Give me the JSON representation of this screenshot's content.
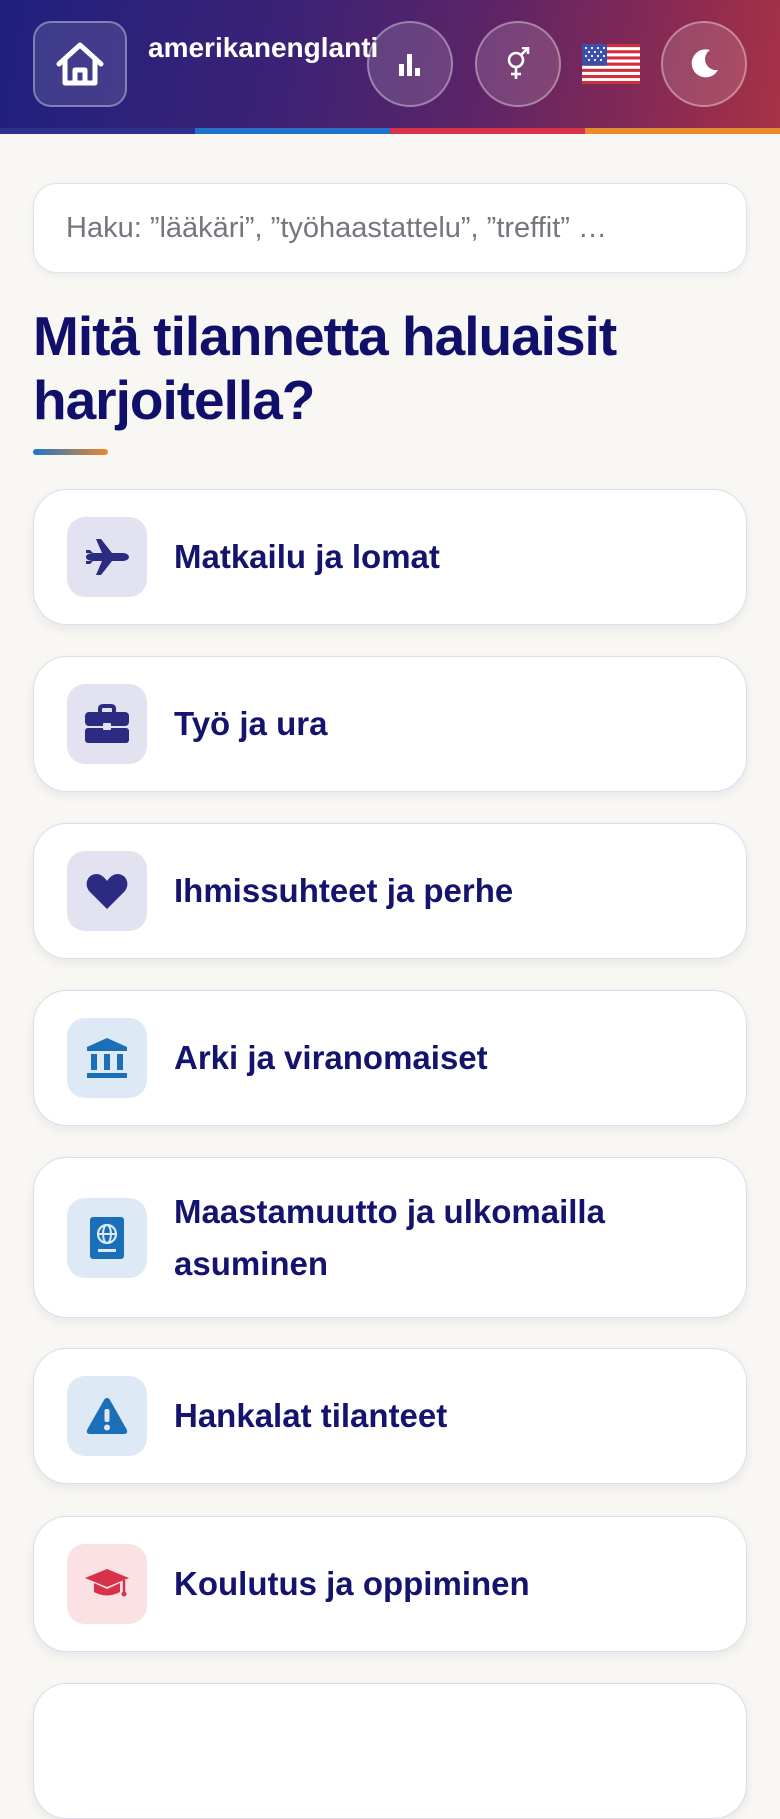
{
  "header": {
    "app_title": "amerikanenglanti roolipeli",
    "flag": "🇺🇸",
    "buttons": {
      "home": "home-icon",
      "stats": "bar-chart-icon",
      "gender": "gender-icon",
      "theme": "moon-icon"
    }
  },
  "search": {
    "placeholder": "Haku: ”lääkäri”, ”työhaastattelu”, ”treffit” …"
  },
  "main": {
    "heading": "Mitä tilannetta haluaisit harjoitella?",
    "categories": [
      {
        "label": "Matkailu ja lomat",
        "icon": "airplane-icon",
        "color": "#2b2b82"
      },
      {
        "label": "Työ ja ura",
        "icon": "briefcase-icon",
        "color": "#2b2b82"
      },
      {
        "label": "Ihmissuhteet ja perhe",
        "icon": "heart-icon",
        "color": "#2b2b82"
      },
      {
        "label": "Arki ja viranomaiset",
        "icon": "bank-icon",
        "color": "#1a6fb8"
      },
      {
        "label": "Maastamuutto ja ulkomailla asuminen",
        "icon": "passport-icon",
        "color": "#1a6fb8"
      },
      {
        "label": "Hankalat tilanteet",
        "icon": "warning-icon",
        "color": "#1a6fb8"
      },
      {
        "label": "Koulutus ja oppiminen",
        "icon": "graduation-cap-icon",
        "color": "#d8324a"
      }
    ]
  }
}
